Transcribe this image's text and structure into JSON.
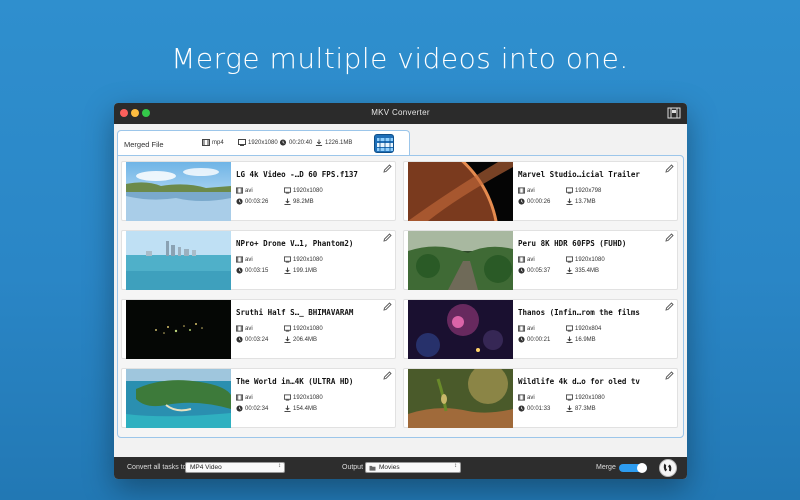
{
  "headline": "Merge multiple videos into one.",
  "window": {
    "title": "MKV Converter"
  },
  "merged": {
    "label": "Merged File",
    "format": "mp4",
    "resolution": "1920x1080",
    "duration": "00:20:40",
    "size": "1226.1MB"
  },
  "videos": [
    {
      "name": "LG 4k Video -…D 60 FPS.f137",
      "format": "avi",
      "resolution": "1920x1080",
      "duration": "00:03:26",
      "size": "98.2MB"
    },
    {
      "name": "Marvel Studio…icial Trailer",
      "format": "avi",
      "resolution": "1920x798",
      "duration": "00:00:26",
      "size": "13.7MB"
    },
    {
      "name": "NPro+ Drone V…1, Phantom2)",
      "format": "avi",
      "resolution": "1920x1080",
      "duration": "00:03:15",
      "size": "199.1MB"
    },
    {
      "name": "Peru 8K HDR 60FPS (FUHD)",
      "format": "avi",
      "resolution": "1920x1080",
      "duration": "00:05:37",
      "size": "335.4MB"
    },
    {
      "name": "Sruthi Half S…_ BHIMAVARAM",
      "format": "avi",
      "resolution": "1920x1080",
      "duration": "00:03:24",
      "size": "206.4MB"
    },
    {
      "name": "Thanos (Infin…rom the films",
      "format": "avi",
      "resolution": "1920x804",
      "duration": "00:00:21",
      "size": "16.9MB"
    },
    {
      "name": "The World in…4K (ULTRA HD)",
      "format": "avi",
      "resolution": "1920x1080",
      "duration": "00:02:34",
      "size": "154.4MB"
    },
    {
      "name": "Wildlife 4k d…o for oled tv",
      "format": "avi",
      "resolution": "1920x1080",
      "duration": "00:01:33",
      "size": "87.3MB"
    }
  ],
  "bottom": {
    "convert_label": "Convert all tasks to",
    "convert_value": "MP4 Video",
    "output_label": "Output",
    "output_value": "Movies",
    "merge_label": "Merge",
    "merge_on": true
  },
  "colors": {
    "accent": "#2d9cf0",
    "background": "#2a86c6",
    "titlebar": "#2b2b2b"
  },
  "icons": [
    "film-icon",
    "monitor-icon",
    "clock-icon",
    "download-icon",
    "pencil-icon",
    "merge-icon",
    "folder-icon",
    "convert-icon"
  ]
}
